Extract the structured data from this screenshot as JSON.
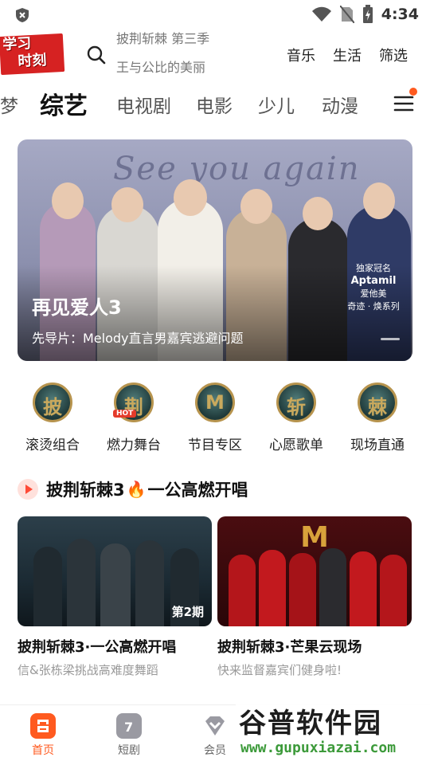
{
  "status_bar": {
    "time": "4:34"
  },
  "header": {
    "logo_line1": "学习",
    "logo_line2": "时刻",
    "search_hint_top": "披荆斩棘 第三季",
    "search_hint_bottom": "王与公比的美丽",
    "links": [
      "音乐",
      "生活",
      "筛选"
    ]
  },
  "tabs": [
    "梦",
    "综艺",
    "电视剧",
    "电影",
    "少儿",
    "动漫"
  ],
  "banner": {
    "script_text": "See you again",
    "title": "再见爱人3",
    "subtitle": "先导片：Melody直言男嘉宾逃避问题",
    "sponsor_label": "独家冠名",
    "sponsor_brand": "Aptamil",
    "sponsor_cn": "爱他美",
    "sponsor_line": "奇迹 · 焕系列"
  },
  "quick_entries": [
    {
      "glyph": "披",
      "label": "滚烫组合"
    },
    {
      "glyph": "荆",
      "label": "燃力舞台",
      "badge": "HOT"
    },
    {
      "glyph": "M",
      "label": "节目专区"
    },
    {
      "glyph": "斩",
      "label": "心愿歌单"
    },
    {
      "glyph": "棘",
      "label": "现场直通"
    }
  ],
  "section": {
    "title_a": "披荆斩棘3",
    "title_b": "一公高燃开唱"
  },
  "cards": [
    {
      "title": "披荆斩棘3·一公高燃开唱",
      "desc": "信&张栋梁挑战高难度舞蹈",
      "episode": "第2期"
    },
    {
      "title": "披荆斩棘3·芒果云现场",
      "desc": "快来监督嘉宾们健身啦!"
    }
  ],
  "bottom_nav": [
    "首页",
    "短剧",
    "会员"
  ],
  "watermark": {
    "text": "谷普软件园",
    "url": "www.gupuxiazai.com"
  },
  "colors": {
    "accent": "#ff5a1f",
    "logo_red": "#d62222"
  }
}
